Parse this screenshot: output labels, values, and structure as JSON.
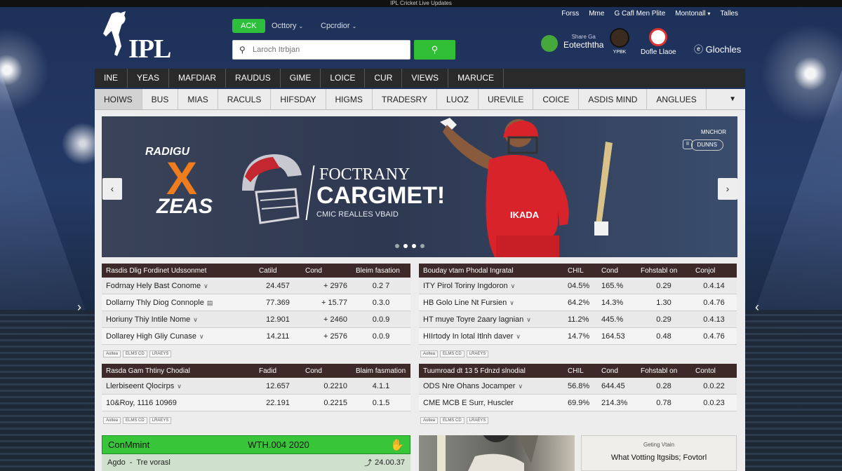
{
  "top_strip": "IPL Cricket Live Updates",
  "header": {
    "logo_text": "IPL",
    "pills": [
      "ACK",
      "Octtory",
      "Cpcrdior"
    ],
    "search_placeholder": "Laroch Itrbjan",
    "search_button_icon": "search-icon",
    "top_links": [
      "Forss",
      "Mme",
      "G Cafl Men Plite",
      "Montonall"
    ],
    "top_links_end": "Talles",
    "users": [
      {
        "sub": "Share Ga",
        "name": "Eotecththa"
      },
      {
        "sub": "",
        "name": "YPBK"
      },
      {
        "sub": "",
        "name": "Dofle Llaoe"
      }
    ],
    "globe_label": "Glochles"
  },
  "nav_primary": [
    "INE",
    "YEAS",
    "MAFDIAR",
    "RAUDUS",
    "GIME",
    "LOICE",
    "CUR",
    "VIEWS",
    "MARUCE"
  ],
  "nav_secondary": [
    "HOIWS",
    "BUS",
    "MIAS",
    "RACULS",
    "HIFSDAY",
    "HIGMS",
    "TRADESRY",
    "LUOZ",
    "UREVILE",
    "COICE",
    "ASDIS MIND",
    "ANGLUES"
  ],
  "banner": {
    "tag": "RADIGU",
    "mark": "X",
    "brand": "ZEAS",
    "headline1": "FOCTRANY",
    "headline2": "CARGMET!",
    "subline": "CMIC REALLES VBAID",
    "mini_title": "MNCHOR",
    "mini_button": "DUNNS",
    "jersey_text": "IKADA"
  },
  "tables": [
    {
      "columns": [
        "Rasdis Dlig Fordinet Udssonmet",
        "Catild",
        "Cond",
        "Bleim fasation"
      ],
      "rows": [
        [
          "Fodrnay Hely Bast Conome",
          "24.457",
          "+ 2976",
          "0.2 7"
        ],
        [
          "Dollarny Thly Diog Connople",
          "77.369",
          "+ 15.77",
          "0.3.0"
        ],
        [
          "Horiuny Thiy Intile Nome",
          "12.901",
          "+ 2460",
          "0.0.9"
        ],
        [
          "Dollarey High Gliy Cunase",
          "14.211",
          "+ 2576",
          "0.0.9"
        ]
      ],
      "footer": [
        "Aoltea",
        "ELMS CD",
        "LRAEYS"
      ]
    },
    {
      "columns": [
        "Bouday vtam Phodal Ingratal",
        "CHIL",
        "Cond",
        "Fohstabl on",
        "Conjol"
      ],
      "rows": [
        [
          "ITY Pirol Toriny Ingdoron",
          "04.5%",
          "165.%",
          "0.29",
          "0.4.14"
        ],
        [
          "HB Golo Line Nt Fursien",
          "64.2%",
          "14.3%",
          "1.30",
          "0.4.76"
        ],
        [
          "HT muye Toyre 2aary lagnian",
          "11.2%",
          "445.%",
          "0.29",
          "0.4.13"
        ],
        [
          "HIIrtody In lotal Itlnh daver",
          "14.7%",
          "164.53",
          "0.48",
          "0.4.76"
        ]
      ],
      "footer": [
        "Aoltea",
        "ELMS CD",
        "LRAEYS"
      ]
    },
    {
      "columns": [
        "Rasda Gam Thtiny Chodial",
        "Fadid",
        "Cond",
        "Blaim fasmation"
      ],
      "rows": [
        [
          "Llerbiseent Qlocirps",
          "12.657",
          "0.2210",
          "4.1.1"
        ],
        [
          "10&Roy, 1116 10969",
          "22.191",
          "0.2215",
          "0.1.5"
        ]
      ],
      "footer": [
        "Aoltea",
        "ELMS CD",
        "LRAEYS"
      ]
    },
    {
      "columns": [
        "Tuumroad dt 13 5 Fdnzd slnodial",
        "CHIL",
        "Cond",
        "Fohstabl on",
        "Contol"
      ],
      "rows": [
        [
          "ODS Nre Ohans Jocamper",
          "56.8%",
          "644.45",
          "0.28",
          "0.0.22"
        ],
        [
          "CME MCB E Surr, Huscler",
          "69.9%",
          "214.3%",
          "0.78",
          "0.0.23"
        ]
      ],
      "footer": [
        "Aoltea",
        "ELMS CD",
        "LRAEYS"
      ]
    }
  ],
  "commit": {
    "title": "ConMmint",
    "date": "WTH.004 2020",
    "sub_label": "Agdo",
    "sub_value": "Tre vorasl",
    "sub_time": "24.00.37"
  },
  "vote": {
    "small": "Geting Vtain",
    "text": "What Votting ltgsibs; Fovtorl"
  }
}
